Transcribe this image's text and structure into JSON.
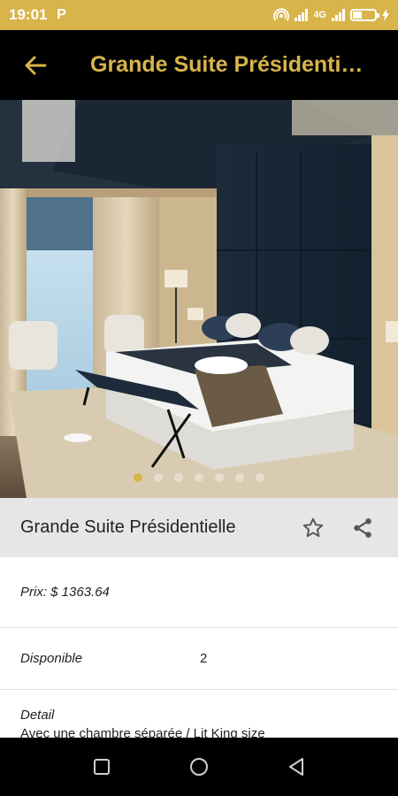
{
  "status_bar": {
    "time": "19:01",
    "app_icon": "P",
    "network_label": "4G",
    "battery_label": ""
  },
  "app_bar": {
    "title": "Grande Suite Présidentielle",
    "back_icon": "arrow-back-icon"
  },
  "gallery": {
    "image_count": 7,
    "active_index": 0
  },
  "room": {
    "name": "Grande Suite Présidentielle",
    "favorite_icon": "star-outline-icon",
    "share_icon": "share-icon"
  },
  "details": {
    "price_label": "Prix: $ 1363.64",
    "availability_label": "Disponible",
    "availability_value": "2",
    "detail_label": "Detail",
    "detail_text": "Avec une chambre séparée / Lit King size"
  },
  "colors": {
    "accent": "#d8b44a",
    "app_bar_bg": "#000000",
    "title_row_bg": "#e6e6e6"
  }
}
